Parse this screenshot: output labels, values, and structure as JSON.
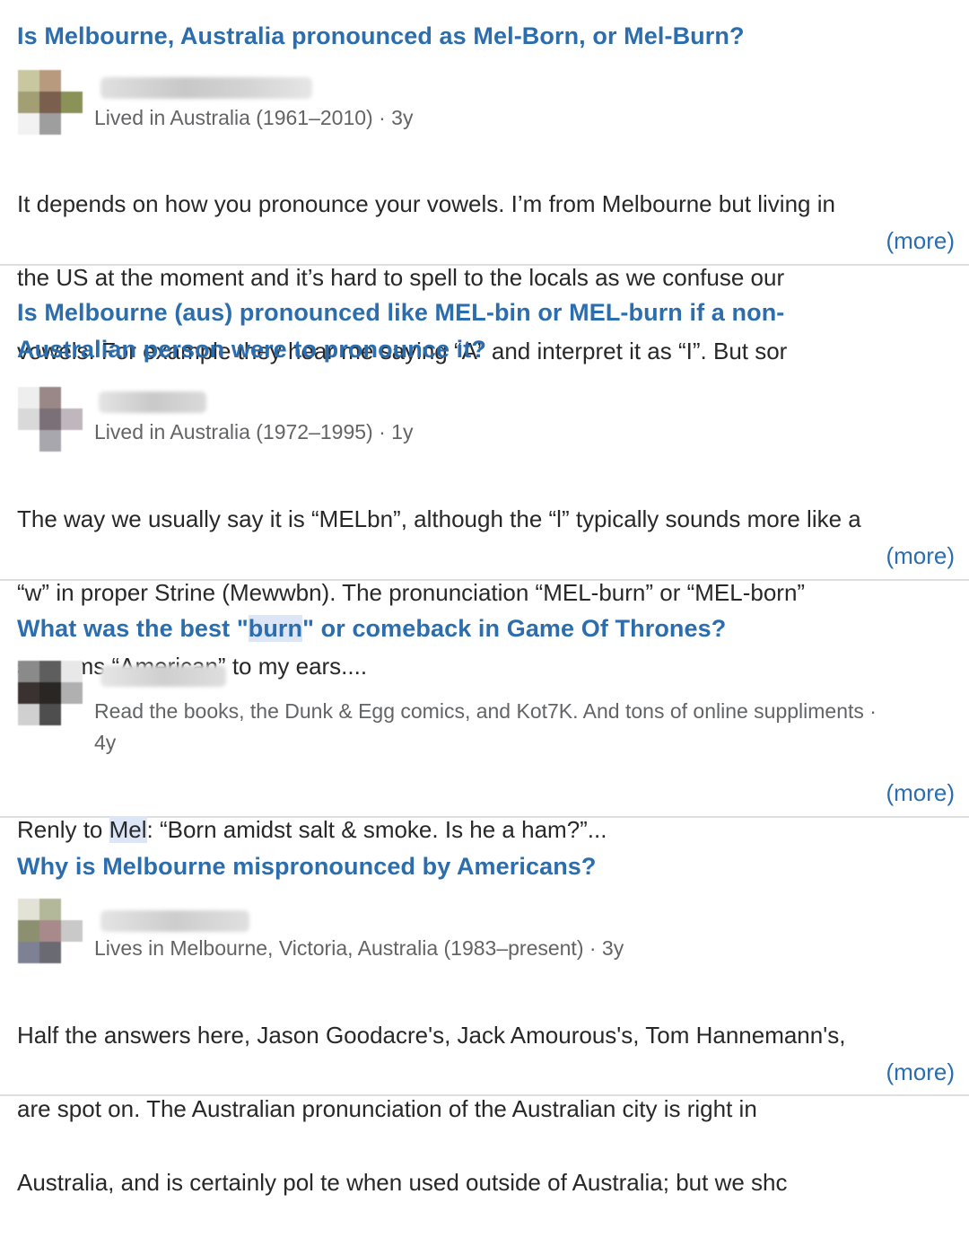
{
  "results": [
    {
      "question": "Is Melbourne, Australia pronounced as Mel-Born, or Mel-Burn?",
      "credential": "Lived in Australia (1961–2010) · 3y",
      "snippet_lines": [
        "It depends on how you pronounce your vowels. I’m from Melbourne but living in",
        "the US at the moment and it’s hard to spell to the locals as we confuse our",
        "vowels. For example they hear me saying “A” and interpret it as “I”. But sor"
      ],
      "more": "(more)"
    },
    {
      "question_line1": "Is Melbourne (aus) pronounced like MEL-bin or MEL-burn if a non-",
      "question_line2": "Australian person were to pronounce it?",
      "credential": "Lived in Australia (1972–1995) · 1y",
      "snippet_lines": [
        "The way we usually say it is “MELbn”, although the “l” typically sounds more like a",
        "“w” in proper Strine (Mewwbn). The pronunciation “MEL-burn” or “MEL-born”",
        "screams “American” to my ears...."
      ],
      "more": "(more)"
    },
    {
      "question_pre": "What was the best \"",
      "question_highlight": "burn",
      "question_post": "\" or comeback in Game Of Thrones?",
      "credential_line1": "Read the books, the Dunk & Egg comics, and Kot7K. And tons of online suppliments ·",
      "credential_line2": "4y",
      "snippet_pre": "Renly to ",
      "snippet_highlight": "Mel",
      "snippet_post": ": “Born amidst salt & smoke. Is he a ham?”...",
      "more": "(more)"
    },
    {
      "question": "Why is Melbourne mispronounced by Americans?",
      "credential": "Lives in Melbourne, Victoria, Australia (1983–present) · 3y",
      "snippet_lines": [
        "Half the answers here, Jason Goodacre's, Jack Amourous's, Tom Hannemann's,",
        "are spot on. The Australian pronunciation of the Australian city is right in",
        "Australia, and is certainly pol te when used outside of Australia; but we shc"
      ],
      "more": "(more)"
    }
  ],
  "colors": {
    "question_link": "#2b6dad",
    "body_text": "#282829",
    "meta_text": "#636466",
    "divider": "#dedfe0",
    "highlight": "#dce6f7"
  }
}
